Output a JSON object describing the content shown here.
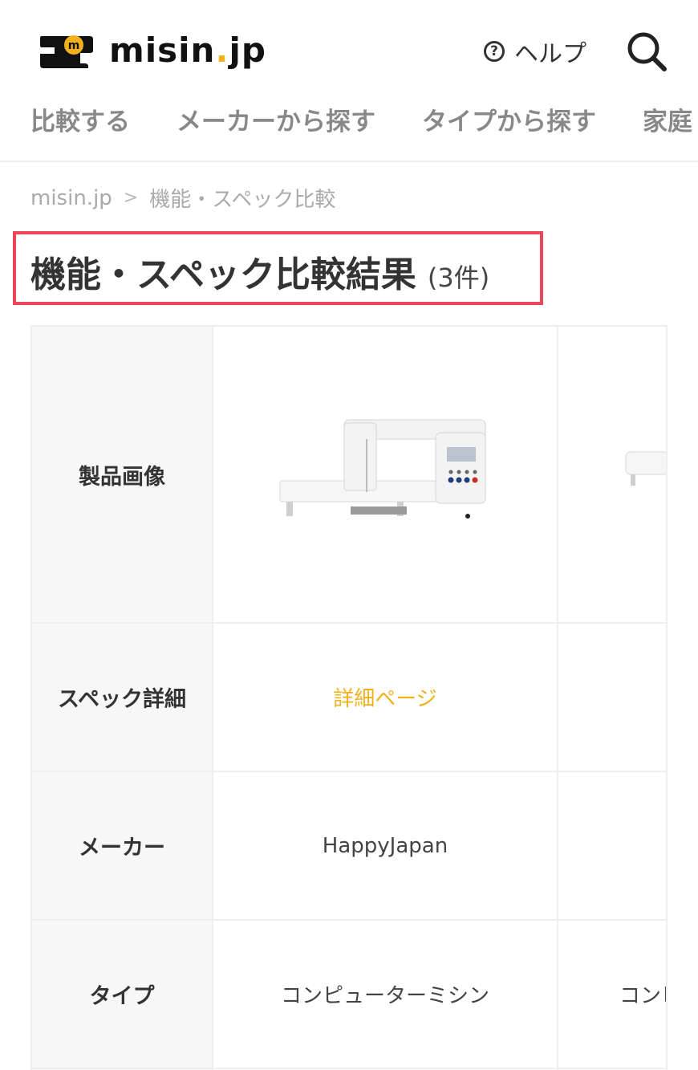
{
  "header": {
    "logo_text": "misin",
    "logo_dot": ".",
    "logo_suffix": "jp",
    "help_label": "ヘルプ",
    "icons": [
      "sewing-machine-logo-icon",
      "help-icon",
      "search-icon"
    ]
  },
  "nav": {
    "items": [
      "比較する",
      "メーカーから探す",
      "タイプから探す",
      "家庭"
    ]
  },
  "breadcrumb": {
    "home": "misin.jp",
    "current": "機能・スペック比較"
  },
  "page": {
    "title": "機能・スペック比較結果",
    "count": "(3件)"
  },
  "table": {
    "rows": {
      "image": "製品画像",
      "spec": "スペック詳細",
      "maker": "メーカー",
      "type": "タイプ"
    },
    "product1": {
      "spec_link": "詳細ページ",
      "maker": "HappyJapan",
      "type": "コンピューターミシン"
    },
    "product2": {
      "type": "コンピ"
    }
  },
  "colors": {
    "accent": "#f2b11c",
    "highlight_border": "#ec4758",
    "nav_text": "#888888",
    "header_cell_bg": "#f7f7f7"
  }
}
